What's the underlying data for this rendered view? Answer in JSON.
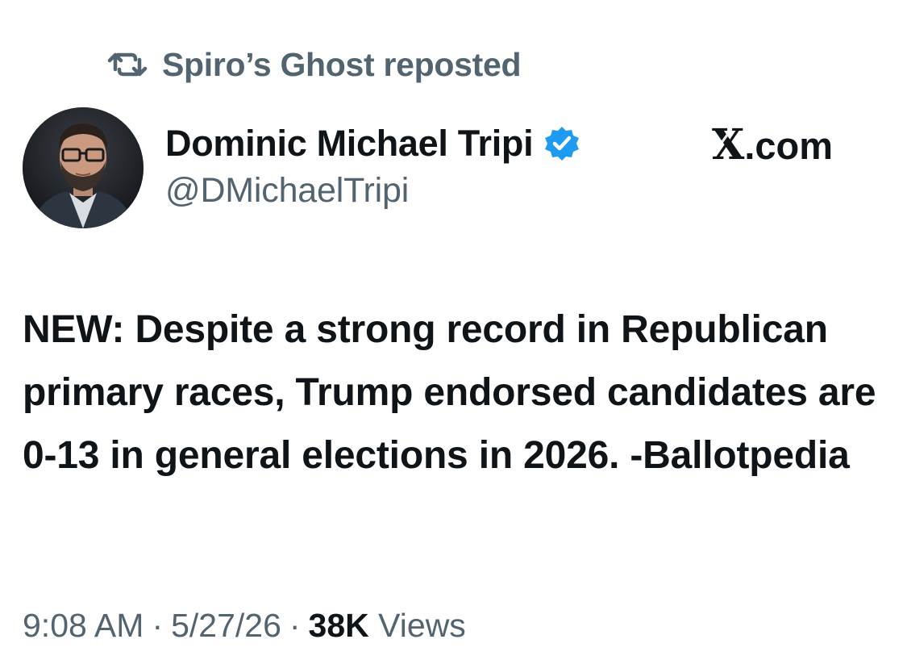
{
  "repost": {
    "icon": "repost-icon",
    "text": "Spiro’s Ghost reposted"
  },
  "author": {
    "display_name": "Dominic Michael Tripi",
    "handle": "@DMichaelTripi",
    "verified_icon": "verified-badge-icon",
    "verified_color": "#1d9bf0",
    "avatar_icon": "profile-photo"
  },
  "brand": {
    "x_glyph": "X",
    "domain": ".com"
  },
  "tweet": {
    "text": "NEW: Despite a strong record in Republican primary races, Trump endorsed candidates are 0-13 in general elections in 2026. -Ballotpedia"
  },
  "meta": {
    "time": "9:08 AM",
    "separator": "·",
    "date": "5/27/26",
    "views_count": "38K",
    "views_label": "Views"
  },
  "colors": {
    "text_primary": "#0f1419",
    "text_secondary": "#536471",
    "background": "#ffffff"
  }
}
